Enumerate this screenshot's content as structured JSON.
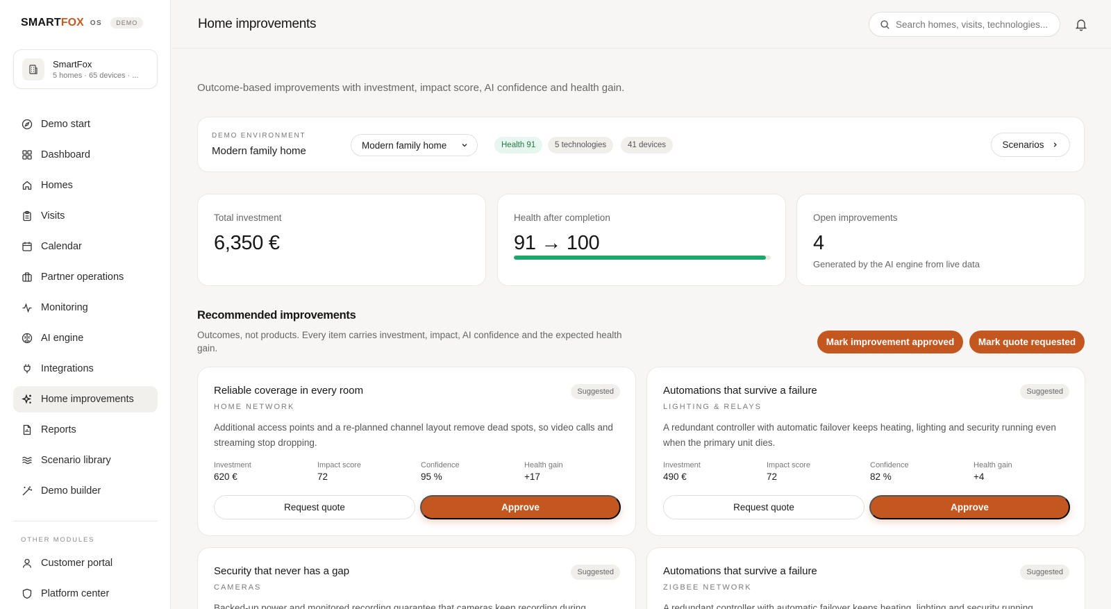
{
  "brand": {
    "name_part1": "SMART",
    "name_part2": "FOX",
    "suffix": "OS",
    "badge": "DEMO"
  },
  "org": {
    "name": "SmartFox",
    "meta": "5 homes · 65 devices · ..."
  },
  "nav": {
    "items": [
      {
        "label": "Demo start",
        "icon": "compass-icon"
      },
      {
        "label": "Dashboard",
        "icon": "grid-icon"
      },
      {
        "label": "Homes",
        "icon": "home-icon"
      },
      {
        "label": "Visits",
        "icon": "clipboard-icon"
      },
      {
        "label": "Calendar",
        "icon": "calendar-icon"
      },
      {
        "label": "Partner operations",
        "icon": "briefcase-icon"
      },
      {
        "label": "Monitoring",
        "icon": "activity-icon"
      },
      {
        "label": "AI engine",
        "icon": "brain-icon"
      },
      {
        "label": "Integrations",
        "icon": "plug-icon"
      },
      {
        "label": "Home improvements",
        "icon": "sparkle-icon",
        "active": true
      },
      {
        "label": "Reports",
        "icon": "report-icon"
      },
      {
        "label": "Scenario library",
        "icon": "waves-icon"
      },
      {
        "label": "Demo builder",
        "icon": "wand-icon"
      }
    ],
    "other_label": "OTHER MODULES",
    "other_items": [
      {
        "label": "Customer portal",
        "icon": "user-icon"
      },
      {
        "label": "Platform center",
        "icon": "shield-icon"
      }
    ]
  },
  "header": {
    "title": "Home improvements",
    "search_placeholder": "Search homes, visits, technologies..."
  },
  "page": {
    "subtitle": "Outcome-based improvements with investment, impact score, AI confidence and health gain."
  },
  "env": {
    "label": "DEMO ENVIRONMENT",
    "value": "Modern family home",
    "select_value": "Modern family home",
    "chips": [
      "Health 91",
      "5 technologies",
      "41 devices"
    ],
    "scenarios_button": "Scenarios"
  },
  "stats": {
    "investment": {
      "label": "Total investment",
      "value": "6,350 €"
    },
    "health": {
      "label": "Health after completion",
      "value": "91 → 100",
      "progress": 0.98
    },
    "open": {
      "label": "Open improvements",
      "value": "4",
      "sub": "Generated by the AI engine from live data"
    }
  },
  "recommended": {
    "title": "Recommended improvements",
    "description": "Outcomes, not products. Every item carries investment, impact, AI confidence and the expected health gain.",
    "approve_all": "Mark improvement approved",
    "quote_all": "Mark quote requested"
  },
  "metric_labels": {
    "investment": "Investment",
    "impact": "Impact score",
    "confidence": "Confidence",
    "gain": "Health gain"
  },
  "buttons": {
    "request_quote": "Request quote",
    "approve": "Approve"
  },
  "cards": [
    {
      "title": "Reliable coverage in every room",
      "badge": "Suggested",
      "category": "HOME NETWORK",
      "description": "Additional access points and a re-planned channel layout remove dead spots, so video calls and streaming stop dropping.",
      "investment": "620 €",
      "impact": "72",
      "confidence": "95 %",
      "gain": "+17"
    },
    {
      "title": "Automations that survive a failure",
      "badge": "Suggested",
      "category": "LIGHTING & RELAYS",
      "description": "A redundant controller with automatic failover keeps heating, lighting and security running even when the primary unit dies.",
      "investment": "490 €",
      "impact": "72",
      "confidence": "82 %",
      "gain": "+4"
    },
    {
      "title": "Security that never has a gap",
      "badge": "Suggested",
      "category": "CAMERAS",
      "description": "Backed-up power and monitored recording guarantee that cameras keep recording during"
    },
    {
      "title": "Automations that survive a failure",
      "badge": "Suggested",
      "category": "ZIGBEE NETWORK",
      "description": "A redundant controller with automatic failover keeps heating, lighting and security running"
    }
  ]
}
